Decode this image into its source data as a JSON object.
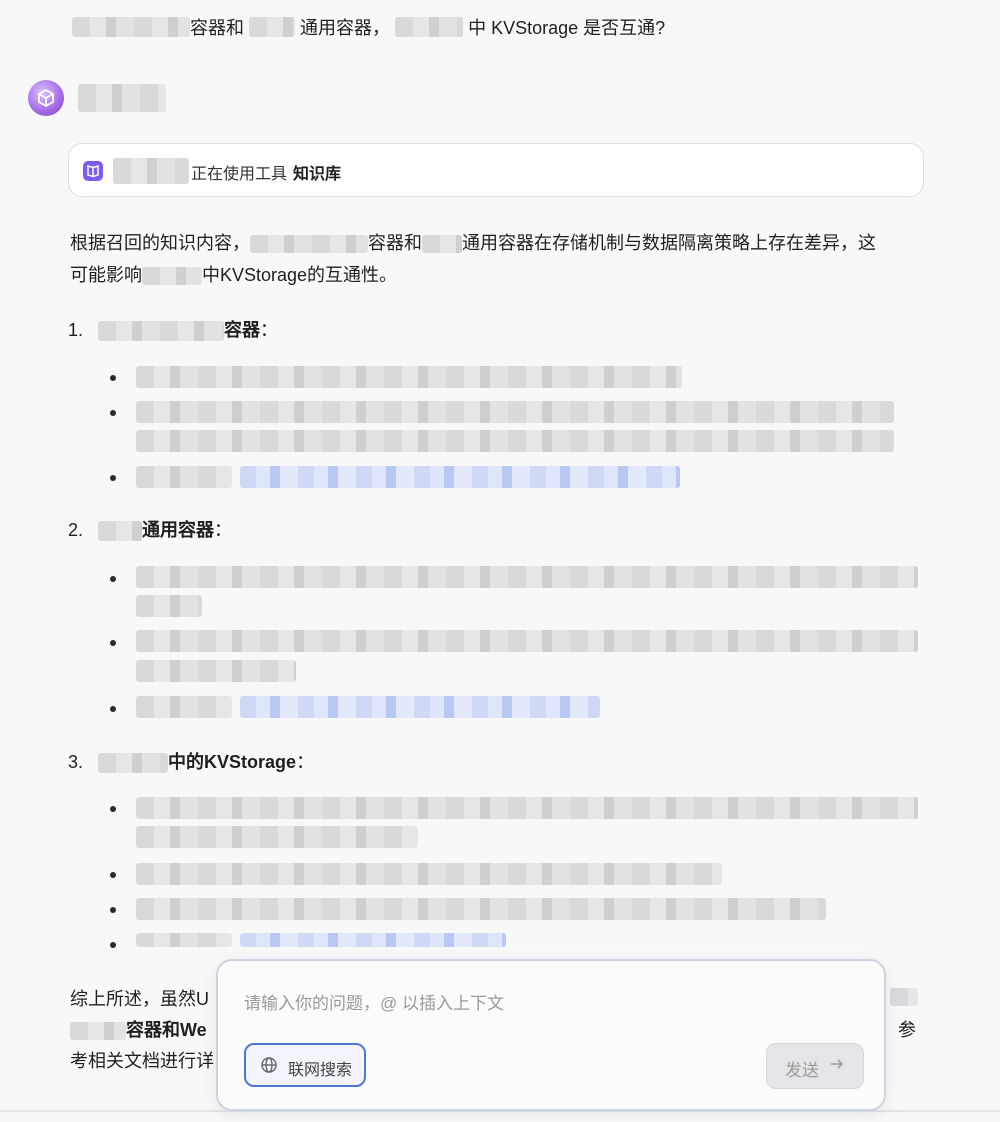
{
  "question": {
    "part1": "容器和",
    "part2": "通用容器，",
    "part3": "中 KVStorage 是否互通?"
  },
  "tool_call": {
    "status": "正在使用工具",
    "tool_name": "知识库"
  },
  "answer": {
    "intro_a": "根据召回的知识内容，",
    "intro_b": "容器和",
    "intro_c": "通用容器在存储机制与数据隔离策略上存在差异，这",
    "intro_d": "可能影响",
    "intro_e": "中KVStorage的互通性。",
    "sections": [
      {
        "number": "1.",
        "title": "容器",
        "colon": "："
      },
      {
        "number": "2.",
        "title": "通用容器",
        "colon": "："
      },
      {
        "number": "3.",
        "title": "中的KVStorage",
        "colon": "："
      }
    ],
    "summary_a": "综上所述，虽然U",
    "summary_b": "容器和We",
    "summary_c": "参",
    "summary_d": "考相关文档进行详"
  },
  "composer": {
    "placeholder": "请输入你的问题，@ 以插入上下文",
    "web_search_label": "联网搜索",
    "send_label": "发送"
  },
  "colors": {
    "accent": "#4f78d6",
    "brand": "#7e5bef"
  }
}
